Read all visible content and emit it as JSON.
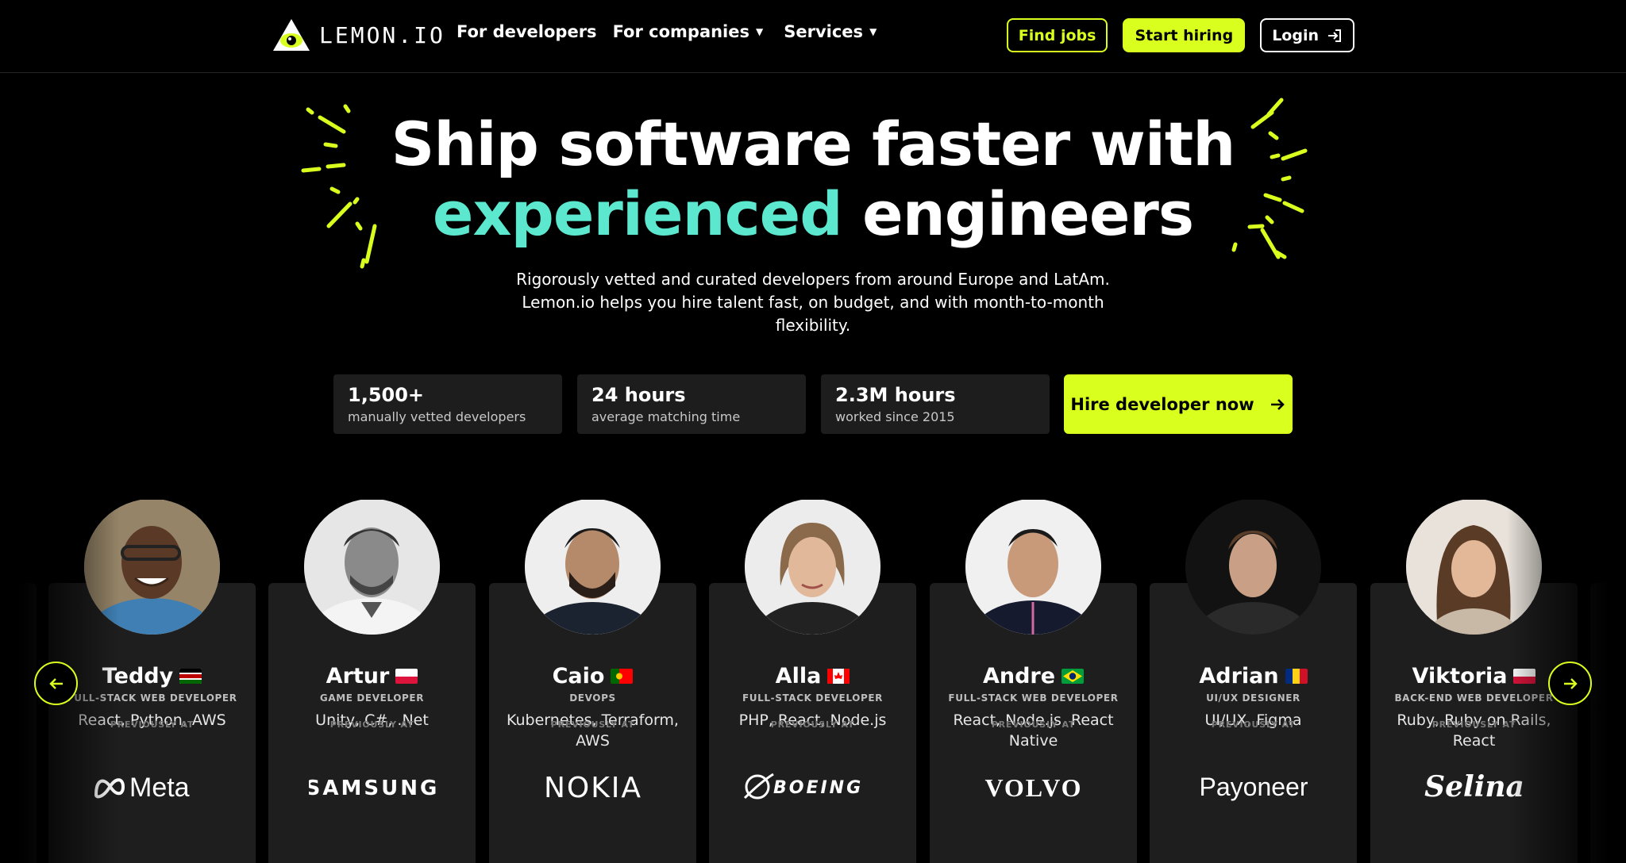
{
  "header": {
    "logo_text": "LEMON.IO",
    "nav": [
      {
        "label": "For developers",
        "has_dropdown": false
      },
      {
        "label": "For companies",
        "has_dropdown": true
      },
      {
        "label": "Services",
        "has_dropdown": true
      }
    ],
    "find_jobs": "Find jobs",
    "start_hiring": "Start hiring",
    "login": "Login"
  },
  "hero": {
    "title_line1": "Ship software faster with",
    "title_accent": "experienced",
    "title_rest": " engineers",
    "subtitle": "Rigorously vetted and curated developers from around Europe and LatAm. Lemon.io helps you hire talent fast, on budget, and with month-to-month flexibility.",
    "stats": [
      {
        "value": "1,500+",
        "label": "manually vetted developers"
      },
      {
        "value": "24 hours",
        "label": "average matching time"
      },
      {
        "value": "2.3M hours",
        "label": "worked since 2015"
      }
    ],
    "cta": "Hire developer now"
  },
  "developers": [
    {
      "name": "Teddy",
      "flag": "kenya-flag",
      "role": "FULL-STACK WEB DEVELOPER",
      "skills": "React, Python, AWS",
      "previously_label": "PREVIOUSLY AT",
      "company": "Meta"
    },
    {
      "name": "Artur",
      "flag": "poland-flag",
      "role": "GAME DEVELOPER",
      "skills": "Unity, C#, .Net",
      "previously_label": "PREVIOUSLY AT",
      "company": "SAMSUNG"
    },
    {
      "name": "Caio",
      "flag": "portugal-flag",
      "role": "DEVOPS",
      "skills": "Kubernetes, Terraform, AWS",
      "previously_label": "PREVIOUSLY AT",
      "company": "NOKIA"
    },
    {
      "name": "Alla",
      "flag": "canada-flag",
      "role": "FULL-STACK DEVELOPER",
      "skills": "PHP, React, Node.js",
      "previously_label": "PREVIOUSLY AT",
      "company": "BOEING"
    },
    {
      "name": "Andre",
      "flag": "brazil-flag",
      "role": "FULL-STACK WEB DEVELOPER",
      "skills": "React, Node.js, React Native",
      "previously_label": "PREVIOUSLY AT",
      "company": "VOLVO"
    },
    {
      "name": "Adrian",
      "flag": "romania-flag",
      "role": "UI/UX DESIGNER",
      "skills": "UI/UX, Figma",
      "previously_label": "PREVIOUSLY AT",
      "company": "Payoneer"
    },
    {
      "name": "Viktoria",
      "flag": "poland-flag",
      "role": "BACK-END WEB DEVELOPER",
      "skills": "Ruby, Ruby on Rails, React",
      "previously_label": "PREVIOUSLY AT",
      "company": "Selina"
    }
  ],
  "colors": {
    "accent": "#d9ff1f",
    "teal": "#5ce8cf",
    "card": "#1e1e1e"
  }
}
